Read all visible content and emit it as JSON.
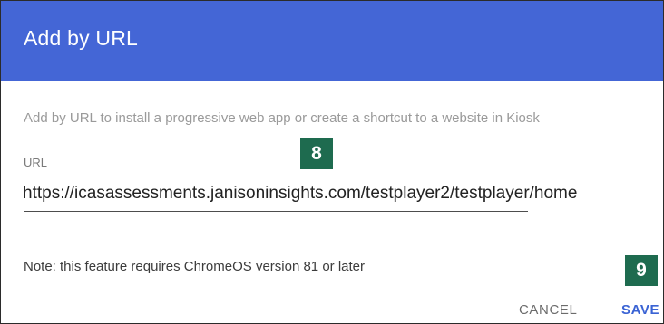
{
  "dialog": {
    "title": "Add by URL",
    "description": "Add by URL to install a progressive web app or create a shortcut to a website in Kiosk",
    "url_label": "URL",
    "url_value": "https://icasassessments.janisoninsights.com/testplayer2/testplayer/home",
    "note": "Note: this feature requires ChromeOS version 81 or later",
    "cancel_label": "CANCEL",
    "save_label": "SAVE"
  },
  "annotations": {
    "badge_url": "8",
    "badge_save": "9"
  },
  "colors": {
    "header": "#4466d6",
    "badge": "#1e6b4f",
    "save_accent": "#3a63d4"
  }
}
